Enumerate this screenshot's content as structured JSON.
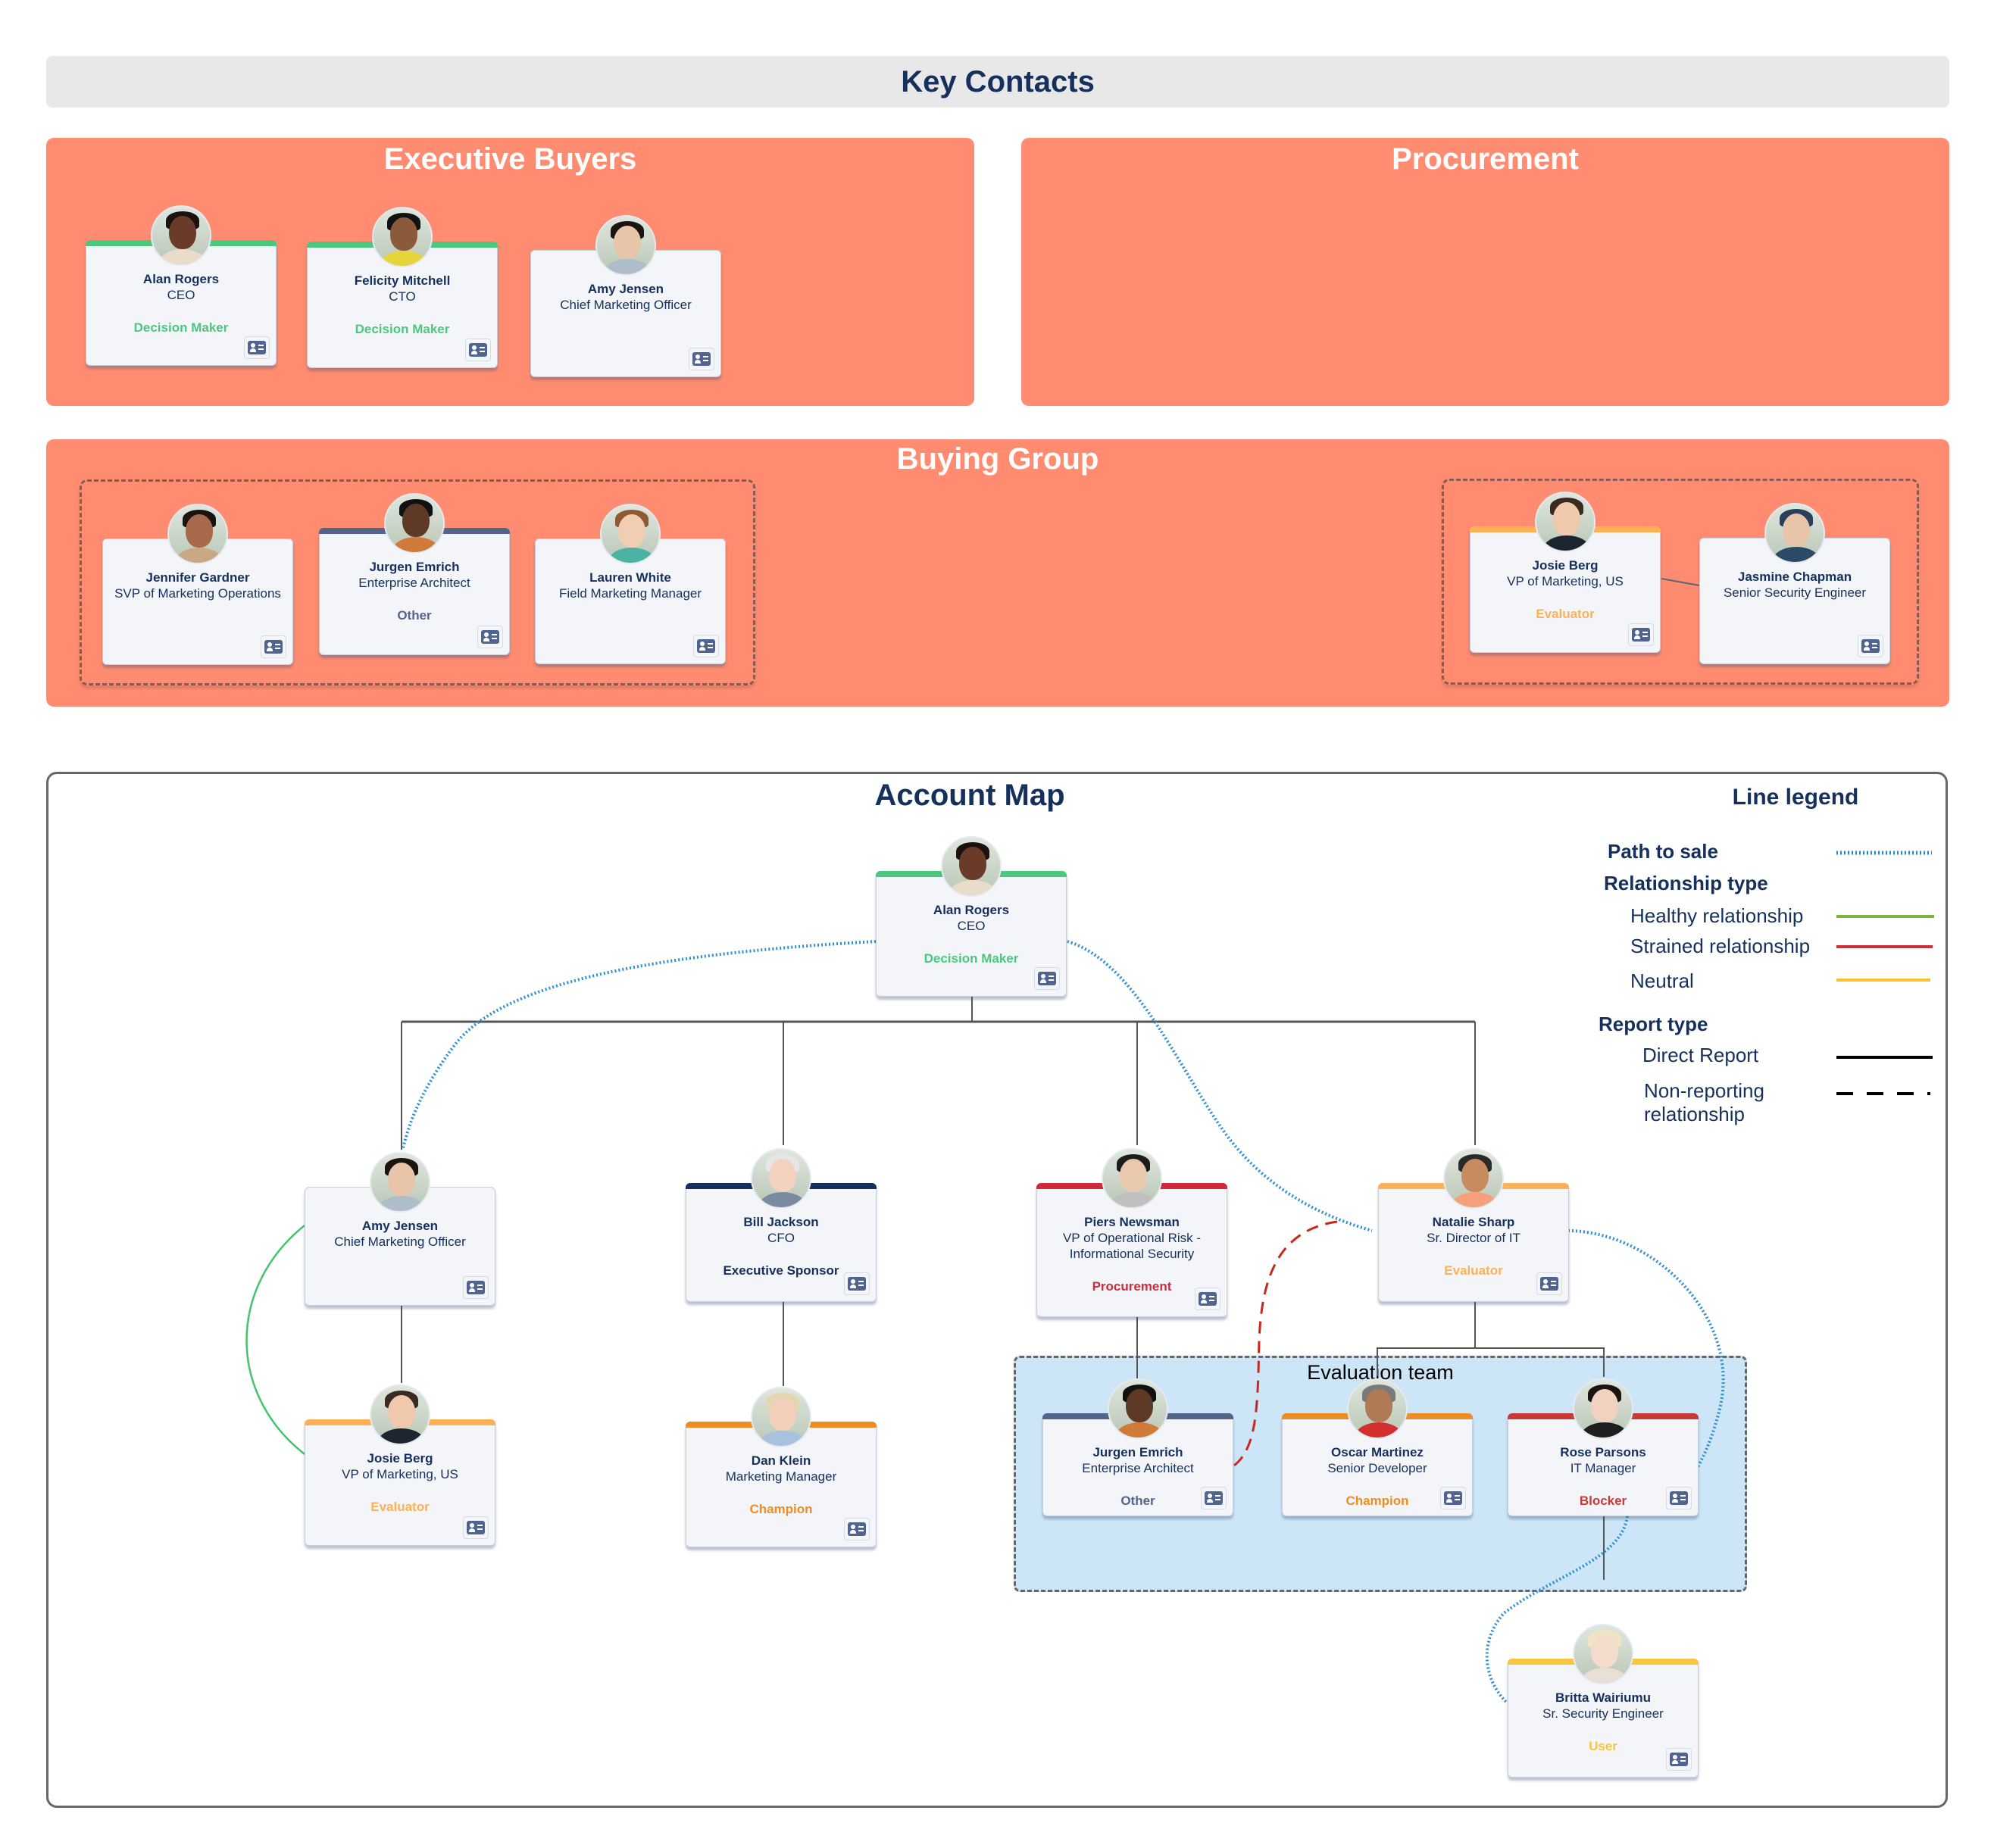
{
  "header": {
    "title": "Key Contacts"
  },
  "panels": {
    "executive_buyers": {
      "title": "Executive Buyers",
      "cards": [
        {
          "name": "Alan Rogers",
          "title": "CEO",
          "role": "Decision Maker",
          "role_color": "#4cc77f",
          "bar_color": "#4cc77f",
          "avatar": "alan-rogers-photo"
        },
        {
          "name": "Felicity Mitchell",
          "title": "CTO",
          "role": "Decision Maker",
          "role_color": "#4cc77f",
          "bar_color": "#4cc77f",
          "avatar": "felicity-mitchell-photo"
        },
        {
          "name": "Amy Jensen",
          "title": "Chief Marketing Officer",
          "role": "",
          "role_color": "",
          "bar_color": "",
          "avatar": "amy-jensen-photo"
        }
      ]
    },
    "procurement": {
      "title": "Procurement",
      "cards": []
    },
    "buying_group": {
      "title": "Buying Group",
      "groups": [
        {
          "cards": [
            {
              "name": "Jennifer Gardner",
              "title": "SVP of Marketing Operations",
              "role": "",
              "bar_color": ""
            },
            {
              "name": "Jurgen Emrich",
              "title": "Enterprise Architect",
              "role": "Other",
              "role_color": "#52648c",
              "bar_color": "#52648c"
            },
            {
              "name": "Lauren White",
              "title": "Field Marketing Manager",
              "role": "",
              "bar_color": ""
            }
          ]
        },
        {
          "cards": [
            {
              "name": "Josie Berg",
              "title": "VP of Marketing, US",
              "role": "Evaluator",
              "role_color": "#fdb157",
              "bar_color": "#fdb157"
            },
            {
              "name": "Jasmine Chapman",
              "title": "Senior Security Engineer",
              "role": "",
              "bar_color": ""
            }
          ]
        }
      ]
    }
  },
  "account_map": {
    "title": "Account Map",
    "evaluation_team_label": "Evaluation team",
    "nodes": {
      "alan": {
        "name": "Alan Rogers",
        "title": "CEO",
        "role": "Decision Maker",
        "role_color": "#4cc77f",
        "bar_color": "#4cc77f"
      },
      "amy": {
        "name": "Amy Jensen",
        "title": "Chief Marketing Officer",
        "role": "",
        "role_color": "",
        "bar_color": ""
      },
      "bill": {
        "name": "Bill Jackson",
        "title": "CFO",
        "role": "Executive Sponsor",
        "role_color": "#15305c",
        "bar_color": "#15305c"
      },
      "piers": {
        "name": "Piers Newsman",
        "title": "VP of Operational Risk - Informational Security",
        "role": "Procurement",
        "role_color": "#cf2a3a",
        "bar_color": "#cf2a3a"
      },
      "natalie": {
        "name": "Natalie Sharp",
        "title": "Sr. Director of IT",
        "role": "Evaluator",
        "role_color": "#fdb157",
        "bar_color": "#fdb157"
      },
      "josie": {
        "name": "Josie Berg",
        "title": "VP of Marketing, US",
        "role": "Evaluator",
        "role_color": "#fdb157",
        "bar_color": "#fdb157"
      },
      "dan": {
        "name": "Dan Klein",
        "title": "Marketing Manager",
        "role": "Champion",
        "role_color": "#ef8d22",
        "bar_color": "#ef8d22"
      },
      "jurgen": {
        "name": "Jurgen Emrich",
        "title": "Enterprise Architect",
        "role": "Other",
        "role_color": "#52648c",
        "bar_color": "#52648c"
      },
      "oscar": {
        "name": "Oscar Martinez",
        "title": "Senior Developer",
        "role": "Champion",
        "role_color": "#ef8d22",
        "bar_color": "#ef8d22"
      },
      "rose": {
        "name": "Rose Parsons",
        "title": "IT Manager",
        "role": "Blocker",
        "role_color": "#c93a36",
        "bar_color": "#c93a36"
      },
      "britta": {
        "name": "Britta Wairiumu",
        "title": "Sr. Security Engineer",
        "role": "User",
        "role_color": "#f9c53e",
        "bar_color": "#f9c53e"
      }
    }
  },
  "legend": {
    "title": "Line legend",
    "path_to_sale": "Path to sale",
    "relationship_type": "Relationship type",
    "healthy": "Healthy relationship",
    "strained": "Strained relationship",
    "neutral": "Neutral",
    "report_type": "Report type",
    "direct_report": "Direct Report",
    "non_reporting": "Non-reporting relationship",
    "colors": {
      "path_to_sale": "#1f8ccf",
      "healthy": "#7cb342",
      "strained": "#d32f3a",
      "neutral": "#fbc02d",
      "direct": "#000000",
      "non_reporting": "#000000"
    }
  }
}
